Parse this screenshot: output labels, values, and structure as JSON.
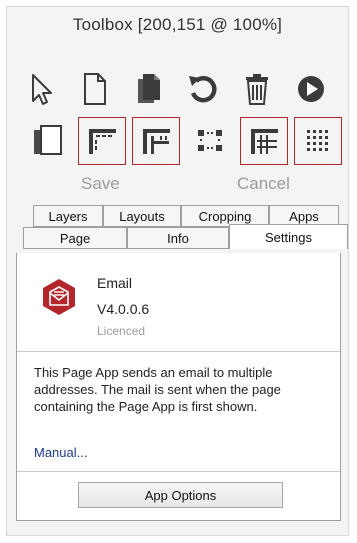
{
  "window": {
    "title": "Toolbox [200,151 @ 100%]"
  },
  "toolbar": {
    "row1": [
      {
        "icon": "pointer-arrow-icon"
      },
      {
        "icon": "new-page-icon"
      },
      {
        "icon": "copy-page-icon"
      },
      {
        "icon": "undo-icon"
      },
      {
        "icon": "trash-icon"
      },
      {
        "icon": "play-icon"
      }
    ],
    "row2": [
      {
        "icon": "duplicate-page-icon",
        "selected": false
      },
      {
        "icon": "corner-ruler-icon",
        "selected": true
      },
      {
        "icon": "grid-ruler-icon",
        "selected": true
      },
      {
        "icon": "corner-dots-icon",
        "selected": false
      },
      {
        "icon": "grid-lines-icon",
        "selected": true
      },
      {
        "icon": "dot-grid-icon",
        "selected": true
      }
    ],
    "save_label": "Save",
    "cancel_label": "Cancel"
  },
  "tabs": {
    "back_row": [
      "Layers",
      "Layouts",
      "Cropping",
      "Apps"
    ],
    "front_row": [
      "Page",
      "Info",
      "Settings"
    ],
    "active": "Settings"
  },
  "app": {
    "name": "Email",
    "version": "V4.0.0.6",
    "license": "Licenced",
    "description": "This Page App sends an email to multiple addresses. The mail is sent when the page containing the Page App is first shown.",
    "manual_link": "Manual...",
    "options_button": "App Options"
  },
  "colors": {
    "accent_red": "#b3262b",
    "icon_dark": "#3b3b3b",
    "link_blue": "#1f3d8f",
    "disabled_text": "#9a9a9a"
  }
}
